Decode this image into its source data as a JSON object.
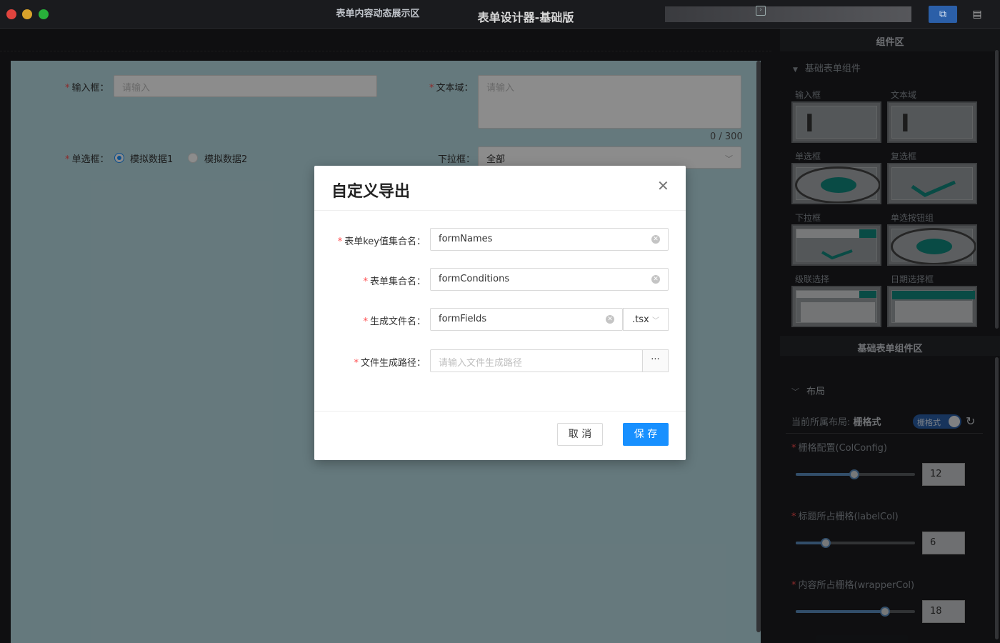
{
  "window": {
    "title": "表单设计器-基础版"
  },
  "left": {
    "header_title": "表单内容动态展示区",
    "form": {
      "input_label": "输入框：",
      "input_placeholder": "请输入",
      "textarea_label": "文本域：",
      "textarea_placeholder": "请输入",
      "textarea_count": "0 / 300",
      "radio_label": "单选框：",
      "radio_options": [
        "模拟数据1",
        "模拟数据2"
      ],
      "select_label": "下拉框：",
      "select_value": "全部"
    }
  },
  "modal": {
    "title": "自定义导出",
    "fields": [
      {
        "label": "表单key值集合名：",
        "value": "formNames"
      },
      {
        "label": "表单集合名：",
        "value": "formConditions"
      },
      {
        "label": "生成文件名：",
        "value": "formFields",
        "suffix": ".tsx"
      },
      {
        "label": "文件生成路径：",
        "placeholder": "请输入文件生成路径",
        "browse": "···"
      }
    ],
    "cancel_label": "取 消",
    "save_label": "保 存",
    "required_mark": "*"
  },
  "right": {
    "header_title": "组件区",
    "group_title": "基础表单组件",
    "components": [
      "输入框",
      "文本域",
      "单选框",
      "复选框",
      "下拉框",
      "单选按钮组",
      "级联选择",
      "日期选择框"
    ],
    "sub_title": "基础表单组件区",
    "layout_title": "布局",
    "current_layout_label": "当前所属布局:",
    "current_layout_value": "栅格式",
    "switch_label": "栅格式",
    "props": [
      {
        "label": "栅格配置(ColConfig)",
        "value": "12",
        "percent": 49
      },
      {
        "label": "标题所占栅格(labelCol)",
        "value": "6",
        "percent": 25
      },
      {
        "label": "内容所占栅格(wrapperCol)",
        "value": "18",
        "percent": 75
      }
    ]
  },
  "colors": {
    "primary": "#1890ff",
    "required": "#ff4d4f",
    "canvas": "#b9dde4"
  }
}
